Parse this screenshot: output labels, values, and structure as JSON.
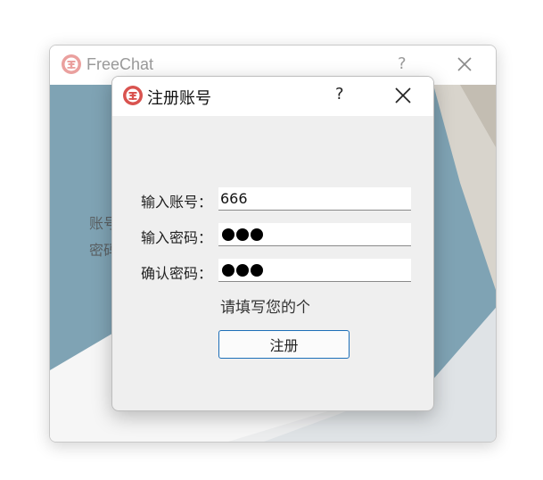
{
  "parent_window": {
    "title": "FreeChat",
    "help_label": "?",
    "account_label_partial": "账号",
    "password_label_partial": "密码"
  },
  "dialog": {
    "title": "注册账号",
    "help_label": "?",
    "fields": [
      {
        "label": "输入账号：",
        "value": "666",
        "type": "text"
      },
      {
        "label": "输入密码：",
        "value": "●●●",
        "type": "password"
      },
      {
        "label": "确认密码：",
        "value": "●●●",
        "type": "password"
      }
    ],
    "hint": "请填写您的个",
    "register_button": "注册"
  },
  "colors": {
    "accent_border": "#1d6fb8",
    "logo_red": "#d9534f",
    "dialog_bg": "#efefef"
  },
  "icons": [
    "freechat-logo-icon",
    "help-icon",
    "close-icon"
  ]
}
